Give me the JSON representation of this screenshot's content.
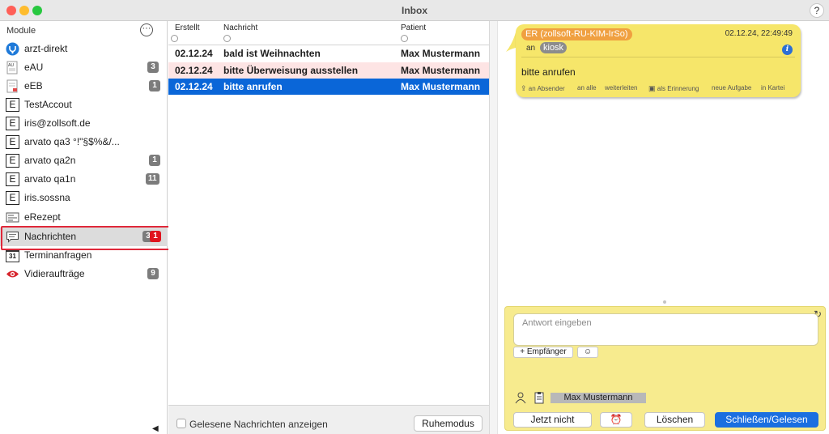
{
  "window": {
    "title": "Inbox",
    "help_label": "?"
  },
  "colors": {
    "selected_row": "#0a66d8",
    "pink_row": "#fde4e4",
    "bubble": "#f6e66a",
    "sender_tag": "#f0a040",
    "primary_button": "#1b6fe0",
    "badge_red": "#e0141e"
  },
  "sidebar": {
    "header": "Module",
    "more_icon": "ellipsis-circle-icon",
    "items": [
      {
        "label": "arzt-direkt",
        "icon": "arzt-direkt-icon",
        "badge": ""
      },
      {
        "label": "eAU",
        "icon": "eau-document-icon",
        "badge": "3"
      },
      {
        "label": "eEB",
        "icon": "eeb-document-icon",
        "badge": "1"
      },
      {
        "label": "TestAccout",
        "icon": "email-e-icon",
        "icon_text": "E",
        "badge": ""
      },
      {
        "label": "iris@zollsoft.de",
        "icon": "email-e-icon",
        "icon_text": "E",
        "badge": ""
      },
      {
        "label": "arvato qa3 °!\"§$%&/...",
        "icon": "email-e-icon",
        "icon_text": "E",
        "badge": ""
      },
      {
        "label": "arvato qa2n",
        "icon": "email-e-icon",
        "icon_text": "E",
        "badge": "1"
      },
      {
        "label": "arvato qa1n",
        "icon": "email-e-icon",
        "icon_text": "E",
        "badge": "11"
      },
      {
        "label": "iris.sossna",
        "icon": "email-e-icon",
        "icon_text": "E",
        "badge": ""
      },
      {
        "label": "eRezept",
        "icon": "erezept-icon",
        "badge": ""
      },
      {
        "label": "Nachrichten",
        "icon": "chat-bubble-icon",
        "badge": "3",
        "badge_unread": "1"
      },
      {
        "label": "Terminanfragen",
        "icon": "calendar-icon",
        "icon_text": "31",
        "badge": ""
      },
      {
        "label": "Vidieraufträge",
        "icon": "eye-icon",
        "badge": "9"
      }
    ],
    "collapse_icon": "triangle-left-icon"
  },
  "messages": {
    "columns": {
      "created": "Erstellt",
      "message": "Nachricht",
      "patient": "Patient"
    },
    "rows": [
      {
        "created": "02.12.24",
        "message": "bald ist Weihnachten",
        "patient": "Max Mustermann",
        "state": "normal"
      },
      {
        "created": "02.12.24",
        "message": "bitte Überweisung ausstellen",
        "patient": "Max Mustermann",
        "state": "highlighted"
      },
      {
        "created": "02.12.24",
        "message": "bitte anrufen",
        "patient": "Max Mustermann",
        "state": "selected"
      }
    ],
    "show_read_label": "Gelesene Nachrichten anzeigen",
    "rest_mode_label": "Ruhemodus"
  },
  "detail": {
    "sender": "ER (zollsoft-RU-KIM-IrSo)",
    "timestamp": "02.12.24, 22:49:49",
    "to_prefix": "an",
    "recipient": "kiosk",
    "info_icon": "info-icon",
    "text": "bitte anrufen",
    "actions": [
      "an Absender",
      "an alle",
      "weiterleiten",
      "als Erinnerung",
      "neue Aufgabe",
      "in Kartei"
    ]
  },
  "reply": {
    "placeholder": "Antwort eingeben",
    "add_recipient_label": "+ Empfänger",
    "emoji_label": "☺",
    "refresh_icon": "refresh-icon",
    "patient": "Max Mustermann",
    "buttons": {
      "not_now": "Jetzt nicht",
      "delete": "Löschen",
      "close_read": "Schließen/Gelesen"
    }
  }
}
